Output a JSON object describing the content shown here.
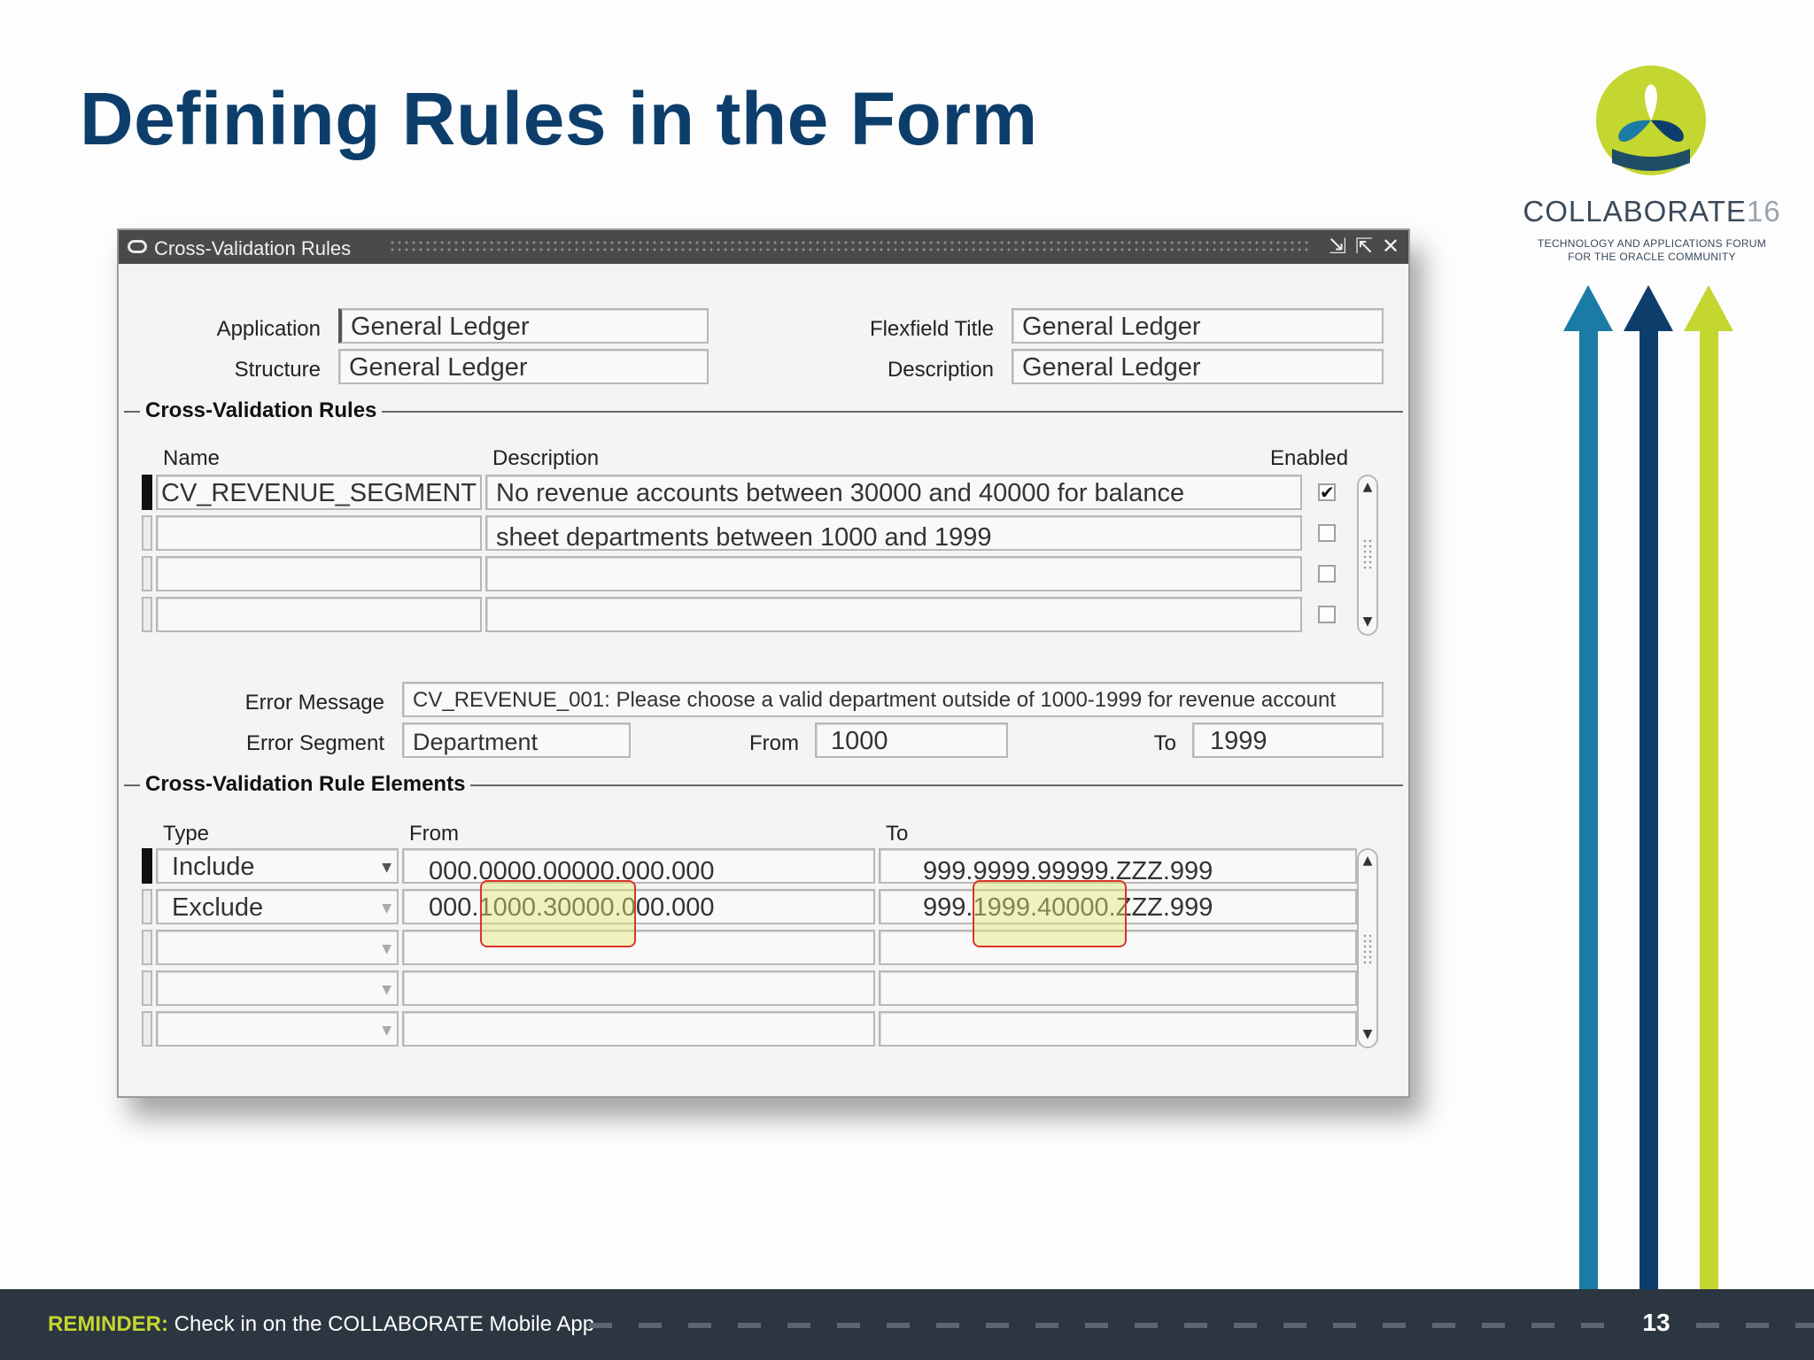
{
  "slide": {
    "title": "Defining Rules in the Form",
    "page_number": "13"
  },
  "logo": {
    "name": "COLLABORATE",
    "year": "16",
    "tagline_1": "TECHNOLOGY AND APPLICATIONS FORUM",
    "tagline_2": "FOR THE ORACLE COMMUNITY"
  },
  "footer": {
    "reminder_keyword": "REMINDER:",
    "reminder_text": "Check in on the COLLABORATE Mobile App"
  },
  "colors": {
    "title": "#0d3e6b",
    "arrow_teal": "#1a7ca4",
    "arrow_navy": "#0d3e6b",
    "arrow_lime": "#c4d630",
    "footer_bg": "#2b3640",
    "highlight_border": "#d9342b"
  },
  "window": {
    "title": "Cross-Validation Rules",
    "controls": [
      "minimize-icon",
      "maximize-icon",
      "close-icon"
    ]
  },
  "header": {
    "application_label": "Application",
    "application_value": "General Ledger",
    "structure_label": "Structure",
    "structure_value": "General Ledger",
    "flexfield_title_label": "Flexfield Title",
    "flexfield_title_value": "General Ledger",
    "description_label": "Description",
    "description_value": "General Ledger"
  },
  "rules": {
    "section_title": "Cross-Validation Rules",
    "columns": {
      "name": "Name",
      "description": "Description",
      "enabled": "Enabled"
    },
    "rows": [
      {
        "name": "CV_REVENUE_SEGMENT",
        "description": "No revenue accounts between 30000 and 40000 for balance",
        "enabled": true
      },
      {
        "name": "",
        "description": "sheet departments between 1000 and 1999",
        "enabled": false
      },
      {
        "name": "",
        "description": "",
        "enabled": false
      },
      {
        "name": "",
        "description": "",
        "enabled": false
      }
    ]
  },
  "error": {
    "message_label": "Error Message",
    "message_value": "CV_REVENUE_001: Please choose a valid department outside of 1000-1999 for revenue account",
    "segment_label": "Error Segment",
    "segment_value": "Department",
    "from_label": "From",
    "from_value": "1000",
    "to_label": "To",
    "to_value": "1999"
  },
  "elements": {
    "section_title": "Cross-Validation Rule Elements",
    "columns": {
      "type": "Type",
      "from": "From",
      "to": "To"
    },
    "rows": [
      {
        "type": "Include",
        "from": "000.0000.00000.000.000",
        "to": "999.9999.99999.ZZZ.999"
      },
      {
        "type": "Exclude",
        "from_prefix": "000.",
        "from_highlight": "1000.30000.",
        "from_suffix": "000.000",
        "to_prefix": "999.",
        "to_highlight": "1999.40000.",
        "to_suffix": "ZZZ.999"
      },
      {
        "type": "",
        "from": "",
        "to": ""
      },
      {
        "type": "",
        "from": "",
        "to": ""
      },
      {
        "type": "",
        "from": "",
        "to": ""
      }
    ]
  }
}
